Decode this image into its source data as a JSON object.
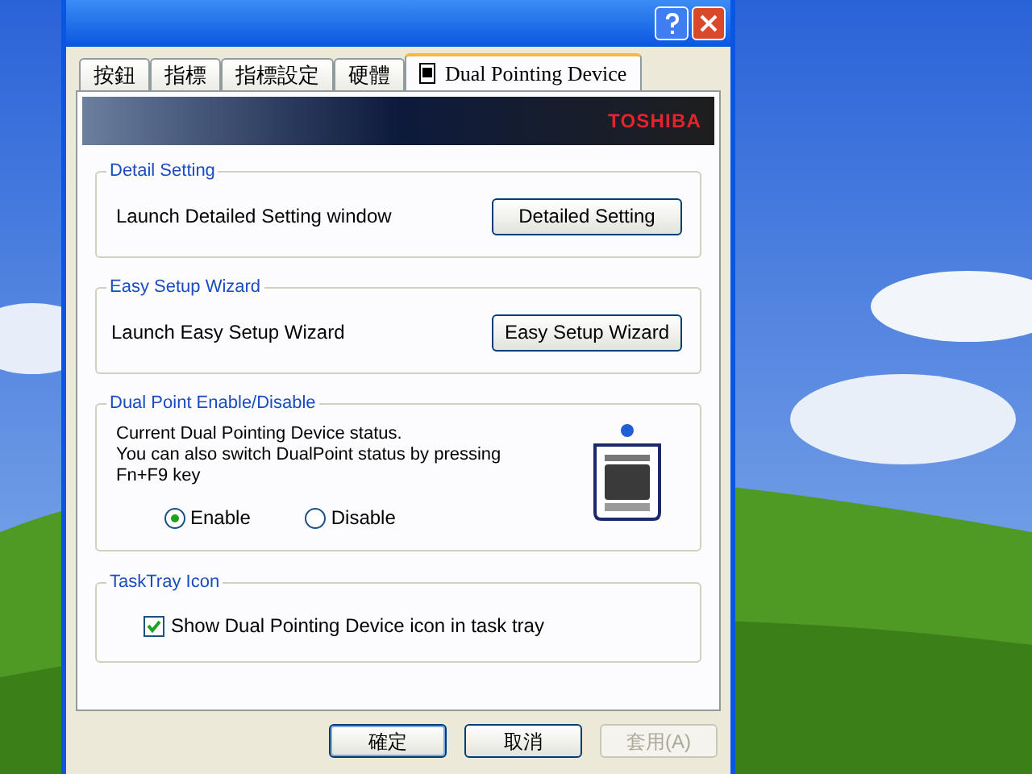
{
  "tabs": [
    {
      "label": "按鈕",
      "selected": false
    },
    {
      "label": "指標",
      "selected": false
    },
    {
      "label": "指標設定",
      "selected": false
    },
    {
      "label": "硬體",
      "selected": false
    },
    {
      "label": "Dual Pointing Device",
      "selected": true,
      "kind": "device"
    }
  ],
  "banner": {
    "brand": "TOSHIBA"
  },
  "detail_setting": {
    "title": "Detail Setting",
    "description": "Launch Detailed Setting window",
    "button": "Detailed Setting"
  },
  "easy_setup": {
    "title": "Easy Setup Wizard",
    "description": "Launch Easy Setup Wizard",
    "button": "Easy Setup Wizard"
  },
  "dual_point": {
    "title": "Dual Point Enable/Disable",
    "lines": [
      "Current Dual Pointing Device status.",
      "You can also switch DualPoint status by pressing",
      "Fn+F9 key"
    ],
    "options": [
      {
        "label": "Enable",
        "selected": true
      },
      {
        "label": "Disable",
        "selected": false
      }
    ],
    "indicator": {
      "on": true
    }
  },
  "task_tray": {
    "title": "TaskTray Icon",
    "checkbox": {
      "label": "Show Dual Pointing Device icon in task tray",
      "checked": true
    }
  },
  "footer_buttons": [
    {
      "label": "確定",
      "default": true,
      "disabled": false
    },
    {
      "label": "取消",
      "default": false,
      "disabled": false
    },
    {
      "label": "套用(A)",
      "default": false,
      "disabled": true
    }
  ]
}
